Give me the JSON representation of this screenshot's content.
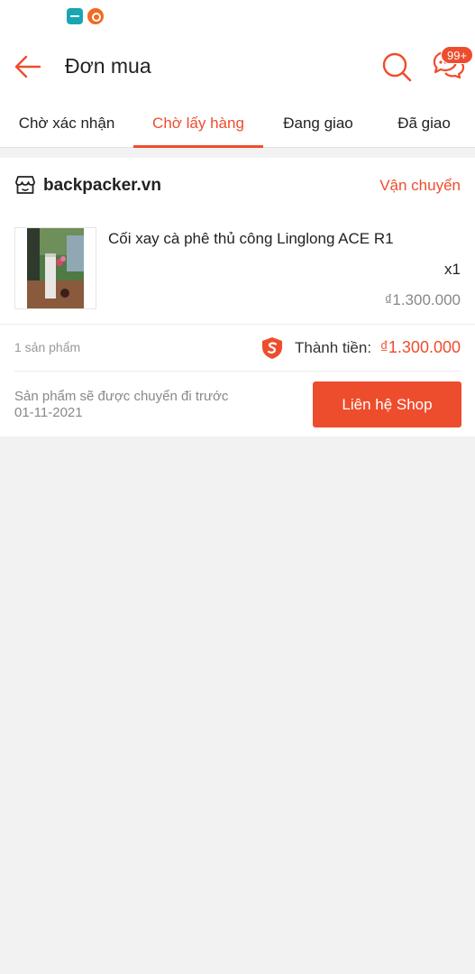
{
  "header": {
    "title": "Đơn mua",
    "chat_badge": "99+"
  },
  "tabs": [
    {
      "label": "Chờ xác nhận"
    },
    {
      "label": "Chờ lấy hàng"
    },
    {
      "label": "Đang giao"
    },
    {
      "label": "Đã giao"
    }
  ],
  "order": {
    "shop_name": "backpacker.vn",
    "shipping_status": "Vận chuyển",
    "product": {
      "name": "Cối xay cà phê thủ công Linglong ACE R1",
      "quantity": "x1",
      "price": "₫1.300.000"
    },
    "item_count": "1 sản phẩm",
    "total_label": "Thành tiền:",
    "total_value": "₫1.300.000",
    "ship_note_line1": "Sản phẩm sẽ được chuyển đi trước",
    "ship_note_line2": "01-11-2021",
    "contact_button": "Liên hệ Shop"
  },
  "colors": {
    "accent": "#ee4d2d",
    "background": "#f2f2f2"
  }
}
